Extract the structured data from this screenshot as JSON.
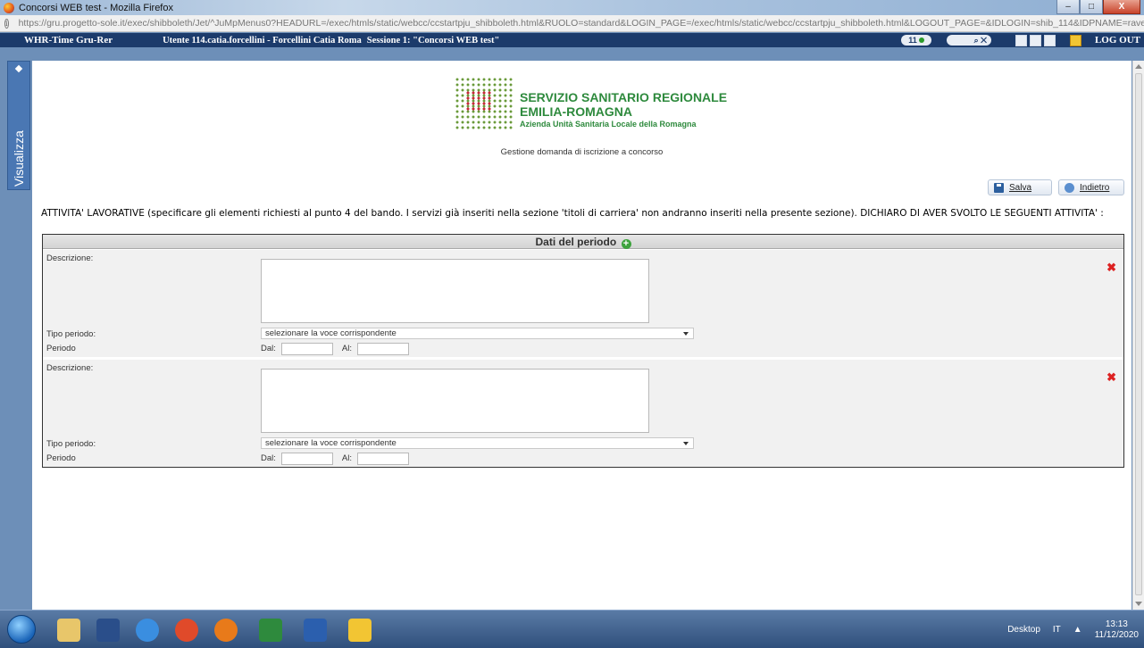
{
  "window": {
    "title": "Concorsi WEB test - Mozilla Firefox",
    "controls": {
      "minimize": "–",
      "maximize": "□",
      "close": "X"
    }
  },
  "browser": {
    "url": "https://gru.progetto-sole.it/exec/shibboleth/Jet/^JuMpMenus0?HEADURL=/exec/htmls/static/webcc/ccstartpju_shibboleth.html&RUOLO=standard&LOGIN_PAGE=/exec/htmls/static/webcc/ccstartpju_shibboleth.html&LOGOUT_PAGE=&IDLOGIN=shib_114&IDPNAME=ravenna"
  },
  "appbar": {
    "app_name": "WHR-Time Gru-Rer",
    "user": "Utente 114.catia.forcellini - Forcellini Catia Roma",
    "session": "Sessione 1: \"Concorsi WEB test\"",
    "counter": "11",
    "logout": "LOG OUT"
  },
  "sidetab": {
    "label": "Visualizza"
  },
  "logo": {
    "line1": "SERVIZIO SANITARIO REGIONALE",
    "line2": "EMILIA-ROMAGNA",
    "line3": "Azienda Unità Sanitaria Locale della Romagna"
  },
  "page": {
    "subtitle": "Gestione domanda di iscrizione a concorso",
    "save_label": "Salva",
    "back_label": "Indietro",
    "intro": "ATTIVITA' LAVORATIVE (specificare gli elementi richiesti al punto 4 del bando. I servizi già inseriti nella sezione 'titoli di carriera' non andranno inseriti nella presente sezione). DICHIARO DI AVER SVOLTO LE SEGUENTI ATTIVITA' :"
  },
  "panel": {
    "title": "Dati del periodo",
    "entries": [
      {
        "description_label": "Descrizione:",
        "description_value": "",
        "type_label": "Tipo periodo:",
        "type_value": "selezionare la voce corrispondente",
        "period_label": "Periodo",
        "from_label": "Dal:",
        "to_label": "Al:"
      },
      {
        "description_label": "Descrizione:",
        "description_value": "",
        "type_label": "Tipo periodo:",
        "type_value": "selezionare la voce corrispondente",
        "period_label": "Periodo",
        "from_label": "Dal:",
        "to_label": "Al:"
      }
    ]
  },
  "taskbar": {
    "desktop_label": "Desktop",
    "language": "IT",
    "time": "13:13",
    "date": "11/12/2020"
  },
  "colors": {
    "app_header": "#1c3b6b",
    "logo_green": "#2e8a3d",
    "delete_red": "#dd2222",
    "panel_background": "#f1f1f1"
  }
}
